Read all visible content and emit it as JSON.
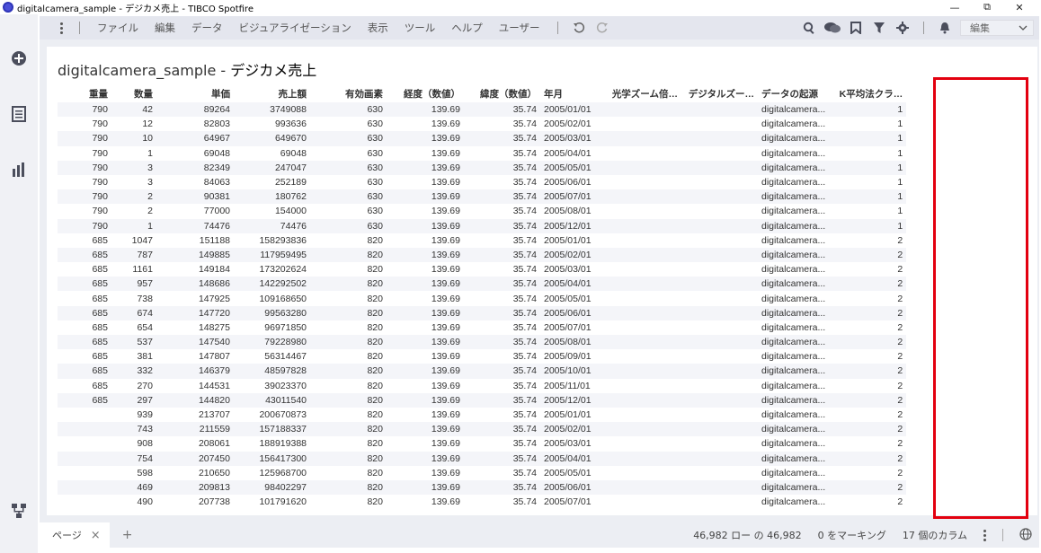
{
  "window": {
    "title": "digitalcamera_sample - デジカメ売上 - TIBCO Spotfire",
    "minimize": "—",
    "restore": "⧉",
    "close": "✕"
  },
  "menu": {
    "items": [
      "ファイル",
      "編集",
      "データ",
      "ビジュアライゼーション",
      "表示",
      "ツール",
      "ヘルプ",
      "ユーザー"
    ],
    "edit_mode": "編集"
  },
  "visualization": {
    "title_main": "digitalcamera_sample - ",
    "title_sub": "デジカメ売上"
  },
  "table": {
    "columns": [
      "重量",
      "数量",
      "単価",
      "売上額",
      "有効画素",
      "経度（数値）",
      "緯度（数値）",
      "年月",
      "光学ズーム倍…",
      "デジタルズー…",
      "データの起源",
      "K平均法クラ…"
    ],
    "rows": [
      [
        "790",
        "42",
        "89264",
        "3749088",
        "630",
        "139.69",
        "35.74",
        "2005/01/01",
        "",
        "",
        "digitalcamera...",
        "1"
      ],
      [
        "790",
        "12",
        "82803",
        "993636",
        "630",
        "139.69",
        "35.74",
        "2005/02/01",
        "",
        "",
        "digitalcamera...",
        "1"
      ],
      [
        "790",
        "10",
        "64967",
        "649670",
        "630",
        "139.69",
        "35.74",
        "2005/03/01",
        "",
        "",
        "digitalcamera...",
        "1"
      ],
      [
        "790",
        "1",
        "69048",
        "69048",
        "630",
        "139.69",
        "35.74",
        "2005/04/01",
        "",
        "",
        "digitalcamera...",
        "1"
      ],
      [
        "790",
        "3",
        "82349",
        "247047",
        "630",
        "139.69",
        "35.74",
        "2005/05/01",
        "",
        "",
        "digitalcamera...",
        "1"
      ],
      [
        "790",
        "3",
        "84063",
        "252189",
        "630",
        "139.69",
        "35.74",
        "2005/06/01",
        "",
        "",
        "digitalcamera...",
        "1"
      ],
      [
        "790",
        "2",
        "90381",
        "180762",
        "630",
        "139.69",
        "35.74",
        "2005/07/01",
        "",
        "",
        "digitalcamera...",
        "1"
      ],
      [
        "790",
        "2",
        "77000",
        "154000",
        "630",
        "139.69",
        "35.74",
        "2005/08/01",
        "",
        "",
        "digitalcamera...",
        "1"
      ],
      [
        "790",
        "1",
        "74476",
        "74476",
        "630",
        "139.69",
        "35.74",
        "2005/12/01",
        "",
        "",
        "digitalcamera...",
        "1"
      ],
      [
        "685",
        "1047",
        "151188",
        "158293836",
        "820",
        "139.69",
        "35.74",
        "2005/01/01",
        "",
        "",
        "digitalcamera...",
        "2"
      ],
      [
        "685",
        "787",
        "149885",
        "117959495",
        "820",
        "139.69",
        "35.74",
        "2005/02/01",
        "",
        "",
        "digitalcamera...",
        "2"
      ],
      [
        "685",
        "1161",
        "149184",
        "173202624",
        "820",
        "139.69",
        "35.74",
        "2005/03/01",
        "",
        "",
        "digitalcamera...",
        "2"
      ],
      [
        "685",
        "957",
        "148686",
        "142292502",
        "820",
        "139.69",
        "35.74",
        "2005/04/01",
        "",
        "",
        "digitalcamera...",
        "2"
      ],
      [
        "685",
        "738",
        "147925",
        "109168650",
        "820",
        "139.69",
        "35.74",
        "2005/05/01",
        "",
        "",
        "digitalcamera...",
        "2"
      ],
      [
        "685",
        "674",
        "147720",
        "99563280",
        "820",
        "139.69",
        "35.74",
        "2005/06/01",
        "",
        "",
        "digitalcamera...",
        "2"
      ],
      [
        "685",
        "654",
        "148275",
        "96971850",
        "820",
        "139.69",
        "35.74",
        "2005/07/01",
        "",
        "",
        "digitalcamera...",
        "2"
      ],
      [
        "685",
        "537",
        "147540",
        "79228980",
        "820",
        "139.69",
        "35.74",
        "2005/08/01",
        "",
        "",
        "digitalcamera...",
        "2"
      ],
      [
        "685",
        "381",
        "147807",
        "56314467",
        "820",
        "139.69",
        "35.74",
        "2005/09/01",
        "",
        "",
        "digitalcamera...",
        "2"
      ],
      [
        "685",
        "332",
        "146379",
        "48597828",
        "820",
        "139.69",
        "35.74",
        "2005/10/01",
        "",
        "",
        "digitalcamera...",
        "2"
      ],
      [
        "685",
        "270",
        "144531",
        "39023370",
        "820",
        "139.69",
        "35.74",
        "2005/11/01",
        "",
        "",
        "digitalcamera...",
        "2"
      ],
      [
        "685",
        "297",
        "144820",
        "43011540",
        "820",
        "139.69",
        "35.74",
        "2005/12/01",
        "",
        "",
        "digitalcamera...",
        "2"
      ],
      [
        "",
        "939",
        "213707",
        "200670873",
        "820",
        "139.69",
        "35.74",
        "2005/01/01",
        "",
        "",
        "digitalcamera...",
        "2"
      ],
      [
        "",
        "743",
        "211559",
        "157188337",
        "820",
        "139.69",
        "35.74",
        "2005/02/01",
        "",
        "",
        "digitalcamera...",
        "2"
      ],
      [
        "",
        "908",
        "208061",
        "188919388",
        "820",
        "139.69",
        "35.74",
        "2005/03/01",
        "",
        "",
        "digitalcamera...",
        "2"
      ],
      [
        "",
        "754",
        "207450",
        "156417300",
        "820",
        "139.69",
        "35.74",
        "2005/04/01",
        "",
        "",
        "digitalcamera...",
        "2"
      ],
      [
        "",
        "598",
        "210650",
        "125968700",
        "820",
        "139.69",
        "35.74",
        "2005/05/01",
        "",
        "",
        "digitalcamera...",
        "2"
      ],
      [
        "",
        "469",
        "209813",
        "98402297",
        "820",
        "139.69",
        "35.74",
        "2005/06/01",
        "",
        "",
        "digitalcamera...",
        "2"
      ],
      [
        "",
        "490",
        "207738",
        "101791620",
        "820",
        "139.69",
        "35.74",
        "2005/07/01",
        "",
        "",
        "digitalcamera...",
        "2"
      ]
    ]
  },
  "bottom": {
    "page_tab": "ページ",
    "page_close": "×",
    "add_page": "+",
    "row_count": "46,982 ロー の 46,982",
    "marking": "0 をマーキング",
    "column_count": "17 個のカラム"
  },
  "colors": {
    "highlight": "#e3000f",
    "accent": "#4a4fd8"
  }
}
